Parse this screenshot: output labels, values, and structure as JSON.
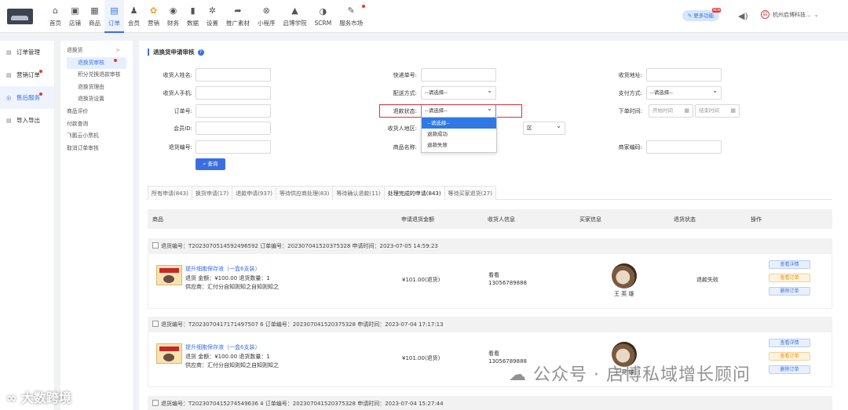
{
  "topnav": [
    {
      "icon": "⌂",
      "label": "首页"
    },
    {
      "icon": "▣",
      "label": "店铺"
    },
    {
      "icon": "▦",
      "label": "商品"
    },
    {
      "icon": "▤",
      "label": "订单"
    },
    {
      "icon": "♟",
      "label": "会员"
    },
    {
      "icon": "✿",
      "label": "营销"
    },
    {
      "icon": "◉",
      "label": "财务"
    },
    {
      "icon": "▮",
      "label": "数据"
    },
    {
      "icon": "✲",
      "label": "设置"
    },
    {
      "icon": "➦",
      "label": "推广素材"
    },
    {
      "icon": "⊗",
      "label": "小程序"
    },
    {
      "icon": "▲",
      "label": "启博学院"
    },
    {
      "icon": "◑",
      "label": "SCRM"
    },
    {
      "icon": "✎",
      "label": "服务市场"
    }
  ],
  "header": {
    "more_label": "更多功能",
    "more_badge": "NEW",
    "shop_seal": "启",
    "shop_name": "杭州启博科技..."
  },
  "side1": [
    {
      "label": "订单管理"
    },
    {
      "label": "营销订单"
    },
    {
      "label": "售后服务"
    },
    {
      "label": "导入导出"
    }
  ],
  "side2": {
    "group1": "退换货",
    "sub": [
      "退换货审核",
      "积分兑换退款审核",
      "退换货理由",
      "退换货设置"
    ],
    "groups": [
      "商品评价",
      "付款查询",
      "飞鹅云小票机",
      "取消订单审核"
    ]
  },
  "page": {
    "title": "退换货申请审核"
  },
  "form": {
    "receiver_name": "收货人姓名:",
    "receiver_phone": "收货人手机:",
    "order_no": "订单号:",
    "member_id": "会员ID:",
    "return_no": "退货编号:",
    "express_no": "快递单号:",
    "delivery": "配送方式:",
    "refund_status": "退款状态:",
    "region": "收货人地区:",
    "product_name": "商品名称:",
    "address": "收货地址:",
    "payment": "支付方式:",
    "order_time": "下单时间:",
    "merchant_code": "商家编码:",
    "please_select": "--请选择--",
    "region_district": "区",
    "start_time": "开始时间",
    "end_time": "结束时间",
    "search_label": "查询"
  },
  "dropdown": [
    "--请选择--",
    "退款成功",
    "退款失败"
  ],
  "tabs": [
    "所有申请(843)",
    "换货申请(17)",
    "退款申请(937)",
    "等待供应商处理(83)",
    "等待确认退款(11)",
    "处理完成的申请(843)",
    "等待买家退货(27)"
  ],
  "table_headers": [
    "商品",
    "申请退货金额",
    "收货人信息",
    "买家信息",
    "退货状态",
    "操作"
  ],
  "orders": [
    {
      "head": "退货编号：T2023070514592496592 订单编号：202307041520375328    申请时间：2023-07-05 14:59:23",
      "product": "提升细胞保存液（一盒6支装）",
      "line1": "退货 金额：¥100.00    退货数量：1",
      "line2": "供应商：汇付分自知则知之自知则知之",
      "amount": "¥101.00(退货)",
      "receiver": "看看",
      "phone": "13056789888",
      "buyer": "王 英 雄",
      "status": "退款失败",
      "ops": [
        "查看详情",
        "查看订单",
        "删除订单"
      ]
    },
    {
      "head": "退货编号：T2023070417171497507 6 订单编号：202307041520375328    申请时间：2023-07-04 17:17:13",
      "product": "提升细胞保存液（一盒6支装）",
      "line1": "退货 金额：¥100.00    退货数量：1",
      "line2": "供应商：汇付分自知则知之自知则知之",
      "amount": "¥101.00(退货)",
      "receiver": "看看",
      "phone": "13056789888",
      "buyer": "王 英 雄",
      "status": "",
      "ops": [
        "查看详情",
        "查看订单",
        "删除订单"
      ]
    },
    {
      "head": "退货编号：T2023070415274549636 4 订单编号：202307041520375328    申请时间：2023-07-04 15:27:44"
    }
  ],
  "watermark": {
    "right": "公众号 · 启博私域增长顾问",
    "left": "大数跨境"
  }
}
